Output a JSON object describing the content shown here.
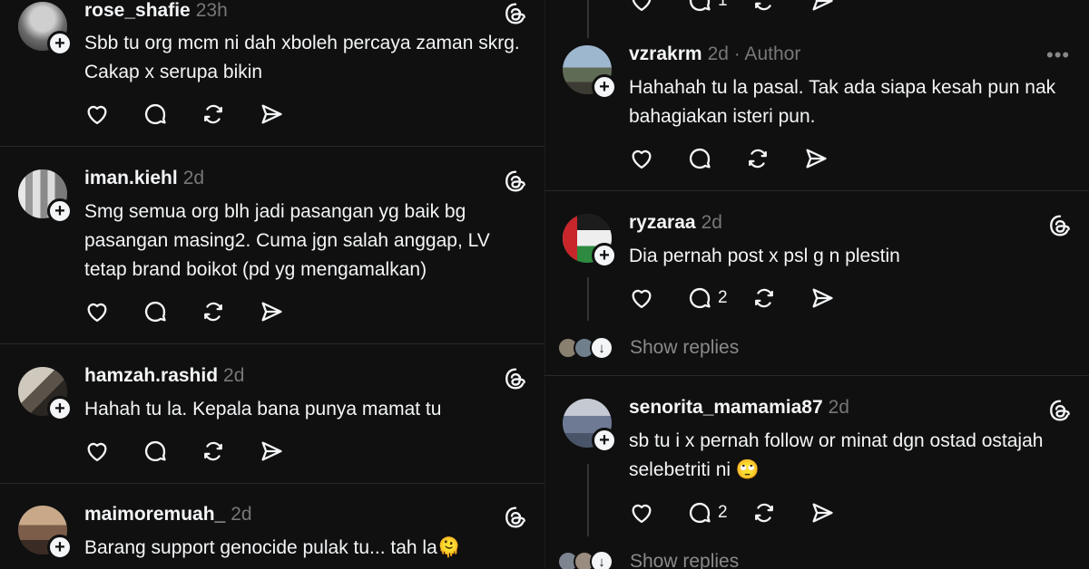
{
  "left_posts": [
    {
      "username": "rose_shafie",
      "time": "23h",
      "text": "Sbb tu org mcm ni dah xboleh percaya zaman skrg. Cakap x serupa bikin"
    },
    {
      "username": "iman.kiehl",
      "time": "2d",
      "text": "Smg semua org blh jadi pasangan yg baik bg pasangan masing2. Cuma jgn salah anggap, LV tetap brand boikot (pd yg mengamalkan)"
    },
    {
      "username": "hamzah.rashid",
      "time": "2d",
      "text": "Hahah tu la. Kepala bana punya mamat tu"
    },
    {
      "username": "maimoremuah_",
      "time": "2d",
      "text": "Barang support genocide pulak tu... tah la🫠"
    }
  ],
  "right_top": {
    "reply_count": "1"
  },
  "right_posts": [
    {
      "username": "vzrakrm",
      "time": "2d",
      "author_label": "· Author",
      "more": "•••",
      "text": "Hahahah tu la pasal. Tak ada siapa kesah pun nak bahagiakan isteri pun."
    },
    {
      "username": "ryzaraa",
      "time": "2d",
      "text": "Dia pernah post x psl g n plestin",
      "reply_count": "2",
      "show_replies": "Show replies"
    },
    {
      "username": "senorita_mamamia87",
      "time": "2d",
      "text": "sb tu i x pernah follow or minat dgn ostad ostajah selebetriti ni 🙄",
      "reply_count": "2",
      "show_replies": "Show replies"
    }
  ],
  "icons": {
    "like": "heart-icon",
    "reply": "comment-icon",
    "repost": "repost-icon",
    "share": "send-icon",
    "threads": "threads-logo-icon",
    "follow": "plus-icon"
  },
  "colors": {
    "background": "#101010",
    "text": "#f3f5f7",
    "muted": "#777777",
    "divider": "#2a2a2a"
  }
}
